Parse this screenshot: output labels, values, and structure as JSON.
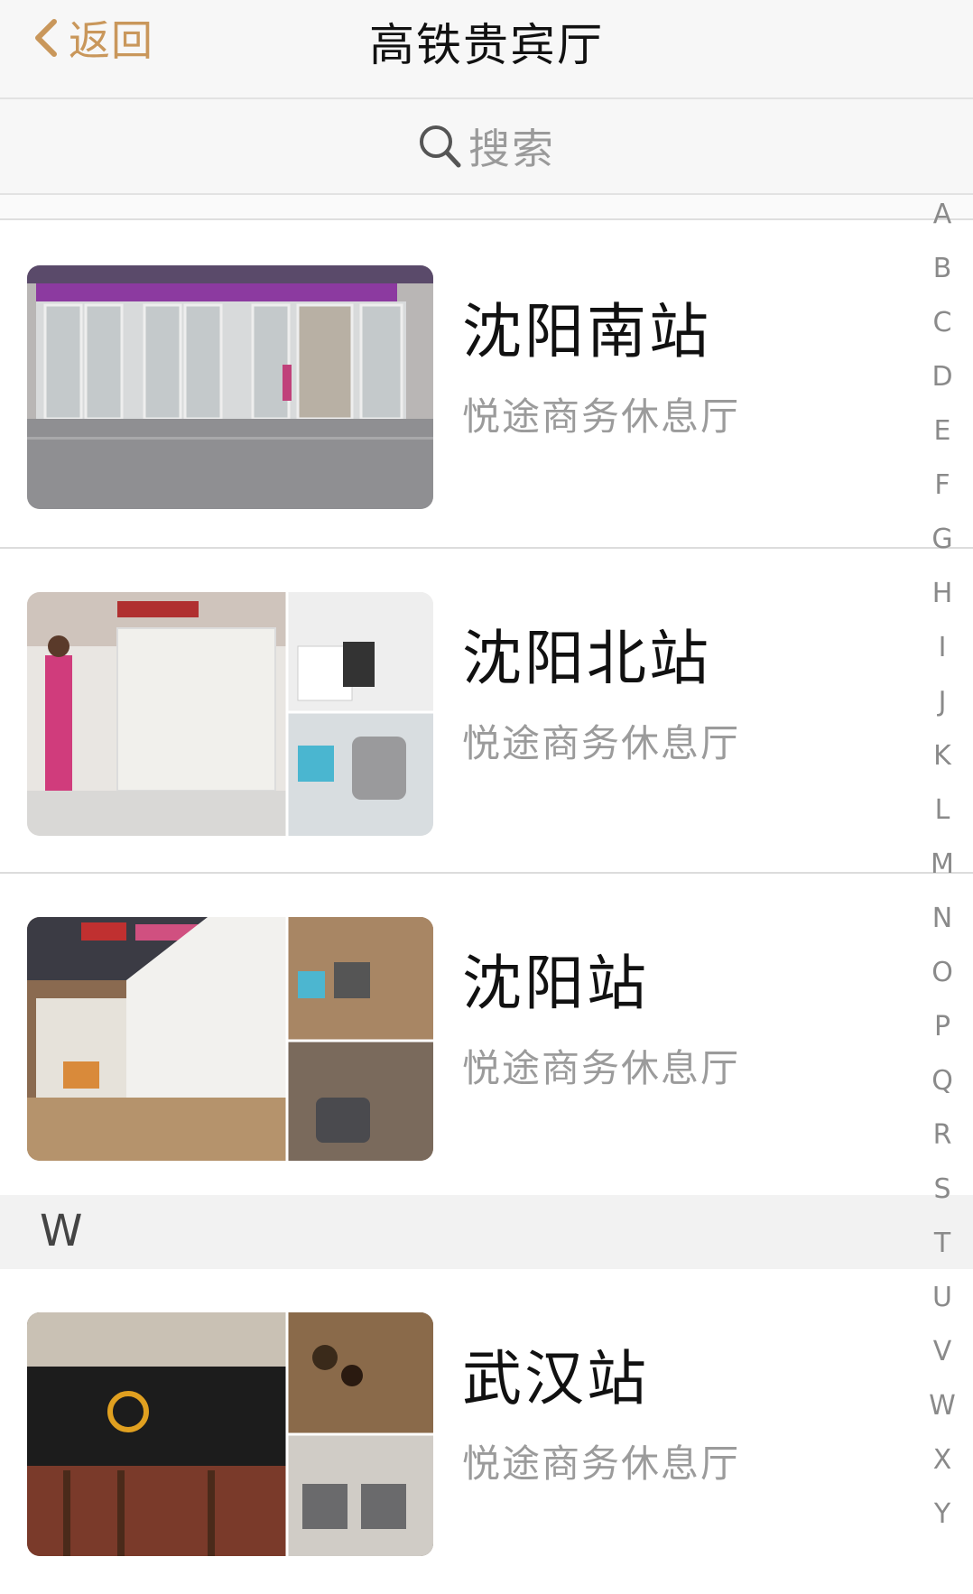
{
  "nav": {
    "back_label": "返回",
    "title": "高铁贵宾厅"
  },
  "search": {
    "placeholder": "搜索"
  },
  "list": [
    {
      "name": "沈阳南站",
      "subtitle": "悦途商务休息厅"
    },
    {
      "name": "沈阳北站",
      "subtitle": "悦途商务休息厅"
    },
    {
      "name": "沈阳站",
      "subtitle": "悦途商务休息厅"
    }
  ],
  "section_w": {
    "header": "W",
    "items": [
      {
        "name": "武汉站",
        "subtitle": "悦途商务休息厅"
      }
    ]
  },
  "index_letters": [
    "A",
    "B",
    "C",
    "D",
    "E",
    "F",
    "G",
    "H",
    "I",
    "J",
    "K",
    "L",
    "M",
    "N",
    "O",
    "P",
    "Q",
    "R",
    "S",
    "T",
    "U",
    "V",
    "W",
    "X",
    "Y"
  ],
  "colors": {
    "accent": "#c9975b",
    "subtitle": "#9b9b9b",
    "index": "#8a8a8a"
  }
}
